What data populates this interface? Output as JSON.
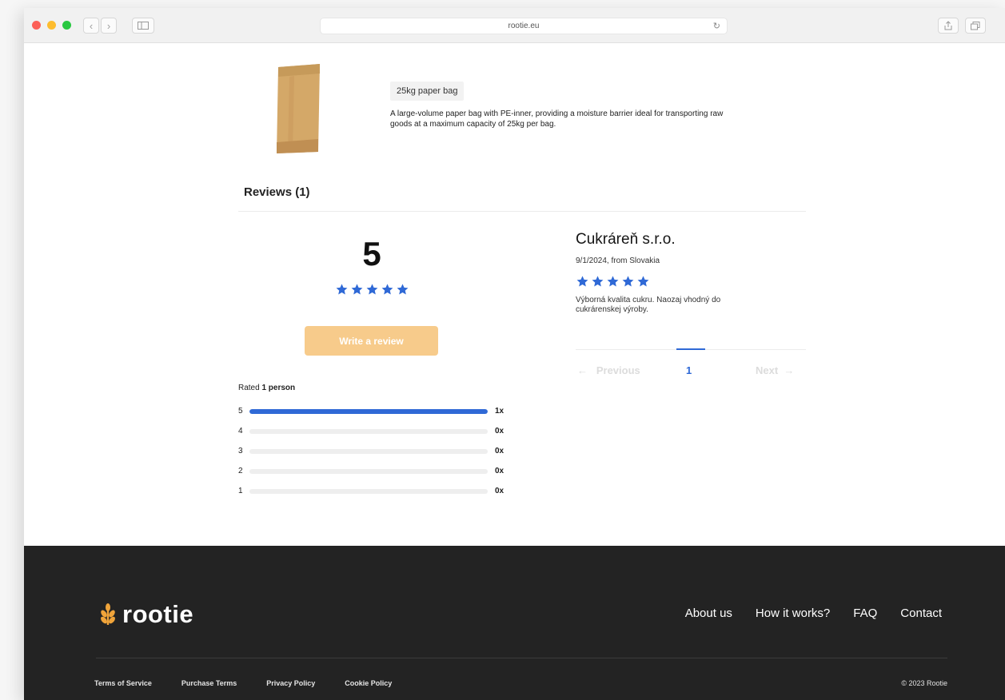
{
  "browser": {
    "url": "rootie.eu"
  },
  "product": {
    "tag": "25kg paper bag",
    "description": "A large-volume paper bag with PE-inner, providing a moisture barrier ideal for transporting raw goods at a maximum capacity of 25kg per bag."
  },
  "reviews": {
    "title": "Reviews (1)",
    "average": "5",
    "average_stars": 5,
    "write_label": "Write a review",
    "rated_prefix": "Rated",
    "rated_count": "1 person",
    "distribution": [
      {
        "stars": "5",
        "count": "1x",
        "fraction": 1.0
      },
      {
        "stars": "4",
        "count": "0x",
        "fraction": 0
      },
      {
        "stars": "3",
        "count": "0x",
        "fraction": 0
      },
      {
        "stars": "2",
        "count": "0x",
        "fraction": 0
      },
      {
        "stars": "1",
        "count": "0x",
        "fraction": 0
      }
    ],
    "items": [
      {
        "author": "Cukráreň s.r.o.",
        "meta": "9/1/2024, from Slovakia",
        "stars": 5,
        "text": "Výborná kvalita cukru. Naozaj vhodný do cukrárenskej výroby."
      }
    ],
    "pagination": {
      "prev": "Previous",
      "current": "1",
      "next": "Next"
    }
  },
  "footer": {
    "brand": "rootie",
    "nav": [
      "About us",
      "How it works?",
      "FAQ",
      "Contact"
    ],
    "legal": [
      "Terms of Service",
      "Purchase Terms",
      "Privacy Policy",
      "Cookie Policy"
    ],
    "copyright": "© 2023 Rootie"
  },
  "colors": {
    "accent": "#2f69d6",
    "button": "#f7cb8b",
    "footer_bg": "#232323",
    "logo_orange": "#f0a43a"
  }
}
